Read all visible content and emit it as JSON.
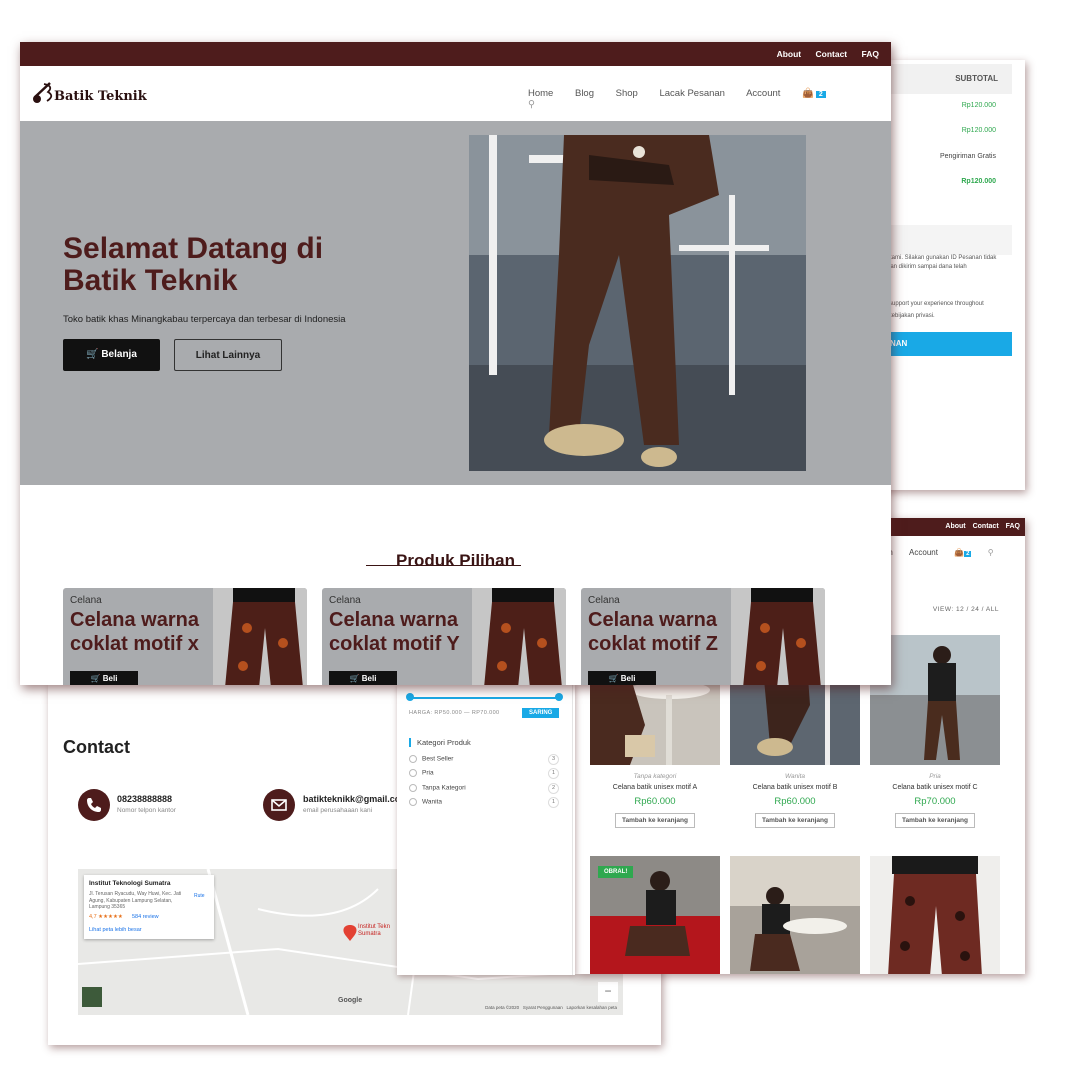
{
  "topbar": {
    "about": "About",
    "contact": "Contact",
    "faq": "FAQ"
  },
  "brand": {
    "name": "Batik Teknik",
    "color_primary": "#4e1c1c",
    "color_accent": "#19a9e6",
    "color_price": "#2fa84f"
  },
  "nav": {
    "home": "Home",
    "blog": "Blog",
    "shop": "Shop",
    "track": "Lacak Pesanan",
    "account": "Account",
    "cart_count": "2",
    "shop_partial": "anan"
  },
  "hero": {
    "title": "Selamat Datang di Batik Teknik",
    "subtitle": "Toko batik khas Minangkabau terpercaya dan terbesar di Indonesia",
    "shop_button": "Belanja",
    "more_button": "Lihat Lainnya"
  },
  "featured": {
    "section_title": "Produk Pilihan",
    "items": [
      {
        "category": "Celana",
        "title": "Celana warna coklat motif x",
        "button": "Beli"
      },
      {
        "category": "Celana",
        "title": "Celana warna coklat motif Y",
        "button": "Beli"
      },
      {
        "category": "Celana",
        "title": "Celana warna coklat motif Z",
        "button": "Beli"
      }
    ]
  },
  "checkout": {
    "subtotal_header": "SUBTOTAL",
    "rows": [
      "Rp120.000",
      "Rp120.000",
      "Pengiriman Gratis",
      "Rp120.000"
    ],
    "note1": "k kami. Silakan gunakan ID Pesanan tidak akan dikirim sampai dana telah",
    "note2": "r, support your experience throughout",
    "note3": "y kebijakan privasi.",
    "button": "NAN"
  },
  "shop": {
    "view_label": "VIEW: 12 / 24 / ALL",
    "products": [
      {
        "category": "Tanpa kategori",
        "name": "Celana batik unisex motif A",
        "price": "Rp60.000",
        "add": "Tambah ke keranjang"
      },
      {
        "category": "Wanita",
        "name": "Celana batik unisex motif B",
        "price": "Rp60.000",
        "add": "Tambah ke keranjang"
      },
      {
        "category": "Pria",
        "name": "Celana batik unisex motif C",
        "price": "Rp70.000",
        "add": "Tambah ke keranjang"
      }
    ],
    "sale_badge": "OBRAL!"
  },
  "filter": {
    "price_range": "HARGA: RP50.000 — RP70.000",
    "filter_button": "SARING",
    "category_title": "Kategori Produk",
    "categories": [
      {
        "name": "Best Seller",
        "count": "3"
      },
      {
        "name": "Pria",
        "count": "1"
      },
      {
        "name": "Tanpa Kategori",
        "count": "2"
      },
      {
        "name": "Wanita",
        "count": "1"
      }
    ]
  },
  "contact": {
    "title": "Contact",
    "phone": "08238888888",
    "phone_label": "Nomor telpon kantor",
    "email": "batikteknikk@gmail.co",
    "email_label": "email perusahaaan kani"
  },
  "map": {
    "place_name": "Institut Teknologi Sumatra",
    "address": "Jl. Terusan Ryacudu, Way Huwi, Kec. Jati Agung, Kabupaten Lampung Selatan, Lampung 35365",
    "rating": "4,7 ★★★★★",
    "reviews": "584 review",
    "larger_map": "Lihat peta lebih besar",
    "route": "Rute",
    "pin_label": "Institut Tekn Sumatra",
    "google": "Google",
    "footer": "Data peta ©2020   Syarat Penggunaan   Laporkan kesalahan peta"
  }
}
